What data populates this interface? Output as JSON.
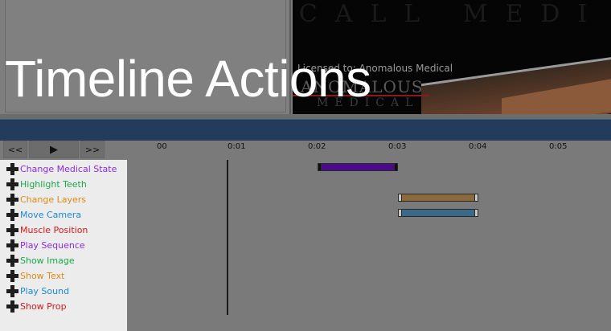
{
  "overlay": {
    "title": "Timeline Actions"
  },
  "viewport": {
    "banner_text": "CALL MEDI",
    "license": "Licensed to: Anomalous Medical",
    "logo_line1": "ANOMALOUS",
    "logo_line2": "MEDICAL"
  },
  "transport": {
    "back": "<<",
    "play": "▶",
    "forward": ">>"
  },
  "ruler": [
    "00",
    "0:01",
    "0:02",
    "0:03",
    "0:04",
    "0:05"
  ],
  "actions": [
    {
      "label": "Change Medical State",
      "color": "#8a2be2"
    },
    {
      "label": "Highlight Teeth",
      "color": "#1aa84a"
    },
    {
      "label": "Change Layers",
      "color": "#e08a1a"
    },
    {
      "label": "Move Camera",
      "color": "#1a8ad8"
    },
    {
      "label": "Muscle Position",
      "color": "#d81a1a"
    },
    {
      "label": "Play Sequence",
      "color": "#8a2be2"
    },
    {
      "label": "Show Image",
      "color": "#1aa84a"
    },
    {
      "label": "Show Text",
      "color": "#e08a1a"
    },
    {
      "label": "Play Sound",
      "color": "#1a8ad8"
    },
    {
      "label": "Show Prop",
      "color": "#d81a1a"
    }
  ],
  "tracks": [
    {
      "action": "Change Medical State",
      "start": 2.0,
      "end": 3.0,
      "color": "#4a0a8a"
    },
    {
      "action": "Change Layers",
      "start": 3.0,
      "end": 4.0,
      "color": "#8a6a3a"
    },
    {
      "action": "Move Camera",
      "start": 3.0,
      "end": 4.0,
      "color": "#3a6a8a"
    }
  ],
  "playhead_time": 0.87
}
